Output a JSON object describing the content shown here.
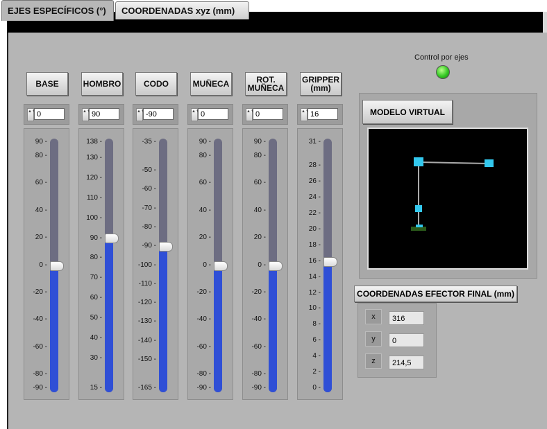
{
  "tabs": [
    {
      "label": "EJES ESPECÍFICOS (°)"
    },
    {
      "label": "COORDENADAS xyz (mm)"
    }
  ],
  "control": {
    "label": "Control por ejes",
    "led_color": "#34c824"
  },
  "joints": [
    {
      "name": "BASE",
      "value": "0",
      "min": -90,
      "max": 90,
      "ticks": [
        "90",
        "80",
        "60",
        "40",
        "20",
        "0",
        "-20",
        "-40",
        "-60",
        "-80",
        "-90"
      ]
    },
    {
      "name": "HOMBRO",
      "value": "90",
      "min": 15,
      "max": 138,
      "ticks": [
        "138",
        "130",
        "120",
        "110",
        "100",
        "90",
        "80",
        "70",
        "60",
        "50",
        "40",
        "30",
        "15"
      ]
    },
    {
      "name": "CODO",
      "value": "-90",
      "min": -165,
      "max": -35,
      "ticks": [
        "-35",
        "-50",
        "-60",
        "-70",
        "-80",
        "-90",
        "-100",
        "-110",
        "-120",
        "-130",
        "-140",
        "-150",
        "-165"
      ]
    },
    {
      "name": "MUÑECA",
      "value": "0",
      "min": -90,
      "max": 90,
      "ticks": [
        "90",
        "80",
        "60",
        "40",
        "20",
        "0",
        "-20",
        "-40",
        "-60",
        "-80",
        "-90"
      ]
    },
    {
      "name": "ROT. MUÑECA",
      "value": "0",
      "min": -90,
      "max": 90,
      "ticks": [
        "90",
        "80",
        "60",
        "40",
        "20",
        "0",
        "-20",
        "-40",
        "-60",
        "-80",
        "-90"
      ]
    },
    {
      "name": "GRIPPER (mm)",
      "value": "16",
      "min": 0,
      "max": 31,
      "ticks": [
        "31",
        "28",
        "26",
        "24",
        "22",
        "20",
        "18",
        "16",
        "14",
        "12",
        "10",
        "8",
        "6",
        "4",
        "2",
        "0"
      ]
    }
  ],
  "model": {
    "button_label": "MODELO VIRTUAL"
  },
  "effector": {
    "button_label": "COORDENADAS EFECTOR FINAL (mm)",
    "coords": [
      {
        "axis": "x",
        "value": "316"
      },
      {
        "axis": "y",
        "value": "0"
      },
      {
        "axis": "z",
        "value": "214,5"
      }
    ]
  },
  "colors": {
    "panel": "#b5b5b5",
    "fill": "#2f4fd6",
    "track": "#6d6d82",
    "cube": "#33c8ee"
  }
}
